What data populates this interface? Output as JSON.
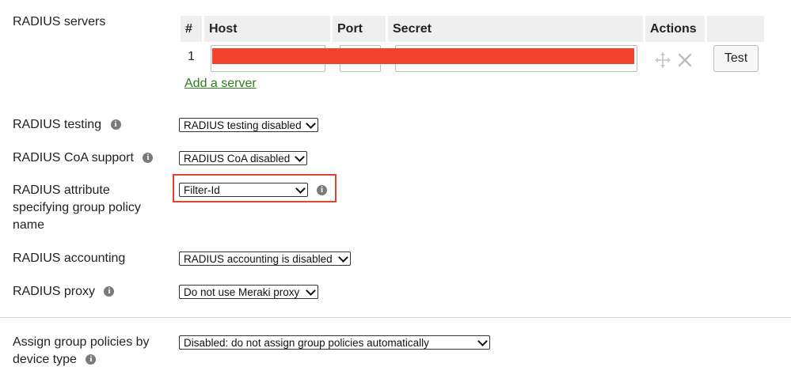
{
  "colors": {
    "accent_link": "#2f7d1c",
    "redaction": "#f2422c",
    "highlight_border": "#e5432d"
  },
  "radius_servers": {
    "label": "RADIUS servers",
    "columns": {
      "num": "#",
      "host": "Host",
      "port": "Port",
      "secret": "Secret",
      "actions": "Actions"
    },
    "rows": [
      {
        "num": "1",
        "test_label": "Test"
      }
    ],
    "add_server": "Add a server"
  },
  "radius_testing": {
    "label": "RADIUS testing",
    "value": "RADIUS testing disabled",
    "icon": "info-icon"
  },
  "radius_coa": {
    "label": "RADIUS CoA support",
    "value": "RADIUS CoA disabled",
    "icon": "info-icon"
  },
  "radius_attribute": {
    "label_line1": "RADIUS attribute",
    "label_line2": "specifying group policy",
    "label_line3": "name",
    "value": "Filter-Id",
    "icon": "info-icon"
  },
  "radius_accounting": {
    "label": "RADIUS accounting",
    "value": "RADIUS accounting is disabled"
  },
  "radius_proxy": {
    "label": "RADIUS proxy",
    "value": "Do not use Meraki proxy",
    "icon": "info-icon"
  },
  "assign_group_policies": {
    "label_line1": "Assign group policies by",
    "label_line2": "device type",
    "value": "Disabled: do not assign group policies automatically",
    "icon": "info-icon"
  }
}
